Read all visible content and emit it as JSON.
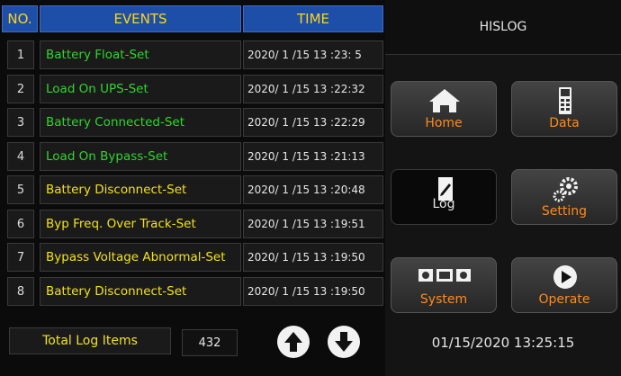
{
  "table": {
    "headers": {
      "no": "NO.",
      "events": "EVENTS",
      "time": "TIME"
    },
    "rows": [
      {
        "no": "1",
        "event": "Battery Float-Set",
        "time": "2020/ 1 /15   13 :23: 5",
        "color": "green"
      },
      {
        "no": "2",
        "event": "Load On UPS-Set",
        "time": "2020/ 1 /15   13 :22:32",
        "color": "green"
      },
      {
        "no": "3",
        "event": "Battery Connected-Set",
        "time": "2020/ 1 /15   13 :22:29",
        "color": "green"
      },
      {
        "no": "4",
        "event": "Load On Bypass-Set",
        "time": "2020/ 1 /15   13 :21:13",
        "color": "green"
      },
      {
        "no": "5",
        "event": "Battery Disconnect-Set",
        "time": "2020/ 1 /15   13 :20:48",
        "color": "yellow"
      },
      {
        "no": "6",
        "event": "Byp Freq. Over Track-Set",
        "time": "2020/ 1 /15   13 :19:51",
        "color": "yellow"
      },
      {
        "no": "7",
        "event": "Bypass Voltage Abnormal-Set",
        "time": "2020/ 1 /15   13 :19:50",
        "color": "yellow"
      },
      {
        "no": "8",
        "event": "Battery Disconnect-Set",
        "time": "2020/ 1 /15   13 :19:50",
        "color": "yellow"
      }
    ]
  },
  "footer": {
    "total_label": "Total Log Items",
    "total_value": "432",
    "up_icon": "arrow-up-icon",
    "down_icon": "arrow-down-icon"
  },
  "panel": {
    "title": "HISLOG",
    "buttons": {
      "home": {
        "label": "Home",
        "icon": "house-icon"
      },
      "data": {
        "label": "Data",
        "icon": "meter-icon"
      },
      "log": {
        "label": "Log",
        "icon": "log-icon"
      },
      "setting": {
        "label": "Setting",
        "icon": "gears-icon"
      },
      "system": {
        "label": "System",
        "icon": "system-icon"
      },
      "operate": {
        "label": "Operate",
        "icon": "play-icon"
      }
    },
    "datetime": "01/15/2020  13:25:15"
  },
  "colors": {
    "header_bg": "#1e4fa8",
    "header_text": "#ffd21a",
    "event_green": "#2ed62e",
    "event_yellow": "#f2e21a",
    "button_label": "#ff8a1a"
  }
}
